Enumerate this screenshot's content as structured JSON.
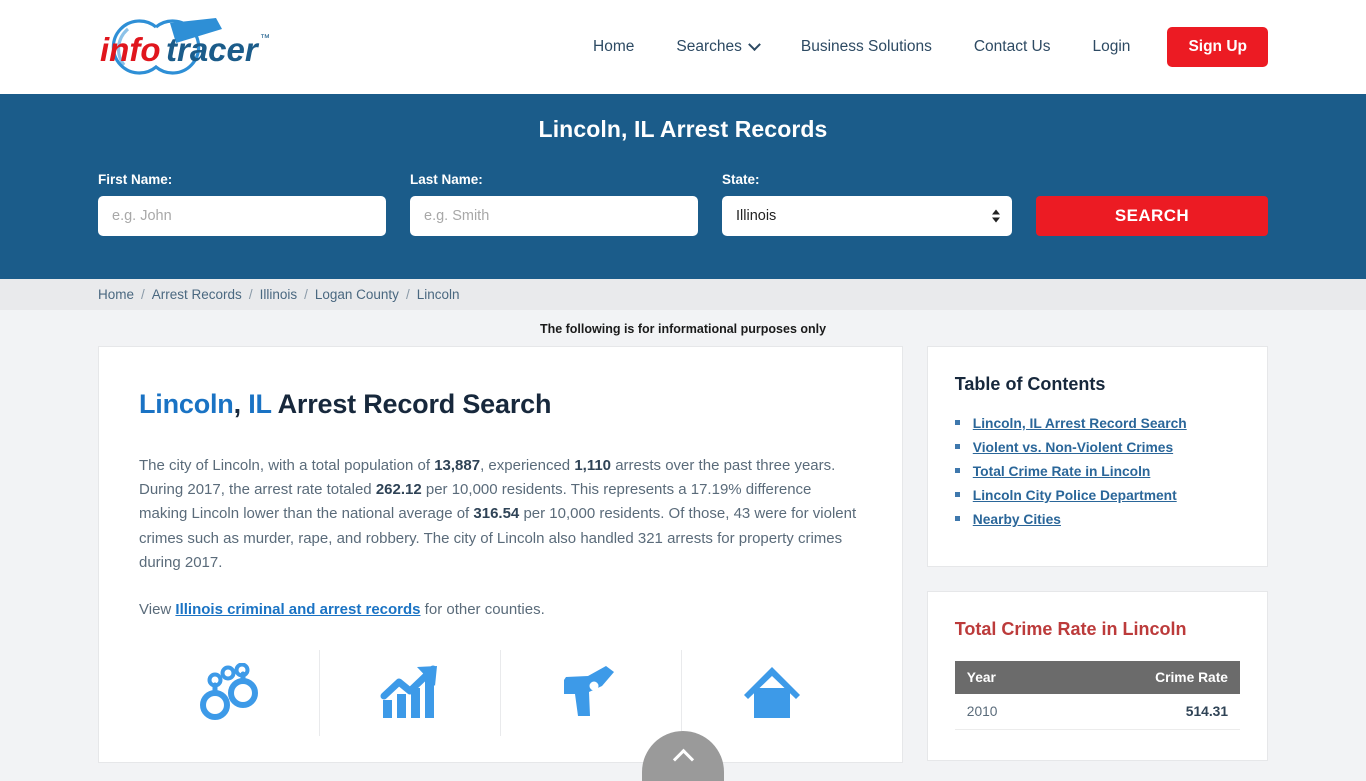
{
  "header": {
    "logo": {
      "part1": "info",
      "part2": "tracer",
      "tm": "™"
    },
    "nav": [
      {
        "label": "Home",
        "has_caret": false
      },
      {
        "label": "Searches",
        "has_caret": true
      },
      {
        "label": "Business Solutions",
        "has_caret": false
      },
      {
        "label": "Contact Us",
        "has_caret": false
      },
      {
        "label": "Login",
        "has_caret": false
      }
    ],
    "signup_label": "Sign Up"
  },
  "banner": {
    "title": "Lincoln, IL Arrest Records",
    "first_name_label": "First Name:",
    "first_name_placeholder": "e.g. John",
    "first_name_value": "",
    "last_name_label": "Last Name:",
    "last_name_placeholder": "e.g. Smith",
    "last_name_value": "",
    "state_label": "State:",
    "state_value": "Illinois",
    "search_label": "SEARCH"
  },
  "breadcrumb": [
    {
      "label": "Home"
    },
    {
      "label": "Arrest Records"
    },
    {
      "label": "Illinois"
    },
    {
      "label": "Logan County"
    },
    {
      "label": "Lincoln"
    }
  ],
  "notice": "The following is for informational purposes only",
  "main": {
    "title_city": "Lincoln",
    "title_comma": ", ",
    "title_state": "IL",
    "title_rest": " Arrest Record Search",
    "paragraph": {
      "p1": "The city of Lincoln, with a total population of ",
      "population": "13,887",
      "p2": ", experienced ",
      "arrests": "1,110",
      "p3": " arrests over the past three years. During 2017, the arrest rate totaled ",
      "arrest_rate": "262.12",
      "p4": " per 10,000 residents. This represents a 17.19% difference making Lincoln lower than the national average of ",
      "national_average": "316.54",
      "p5": " per 10,000 residents. Of those, 43 were for violent crimes such as murder, rape, and robbery. The city of Lincoln also handled 321 arrests for property crimes during 2017."
    },
    "view_prefix": "View ",
    "view_link": "Illinois criminal and arrest records",
    "view_suffix": " for other counties.",
    "icons": [
      {
        "name": "handcuffs-icon"
      },
      {
        "name": "growth-chart-icon"
      },
      {
        "name": "handgun-icon"
      },
      {
        "name": "house-icon"
      }
    ]
  },
  "sidebar": {
    "toc_title": "Table of Contents",
    "toc_items": [
      {
        "label": "Lincoln, IL Arrest Record Search"
      },
      {
        "label": "Violent vs. Non-Violent Crimes"
      },
      {
        "label": "Total Crime Rate in Lincoln"
      },
      {
        "label": "Lincoln City Police Department"
      },
      {
        "label": "Nearby Cities"
      }
    ],
    "crime_title": "Total Crime Rate in Lincoln",
    "table": {
      "columns": [
        "Year",
        "Crime Rate"
      ],
      "rows": [
        {
          "year": "2010",
          "rate": "514.31"
        }
      ]
    }
  },
  "colors": {
    "banner_blue": "#1b5c8a",
    "accent_red": "#ec1b23",
    "link_blue": "#1a73c4",
    "icon_blue": "#3d9ae8",
    "table_header_gray": "#6b6b6b",
    "crime_title_red": "#bc3b3b"
  }
}
